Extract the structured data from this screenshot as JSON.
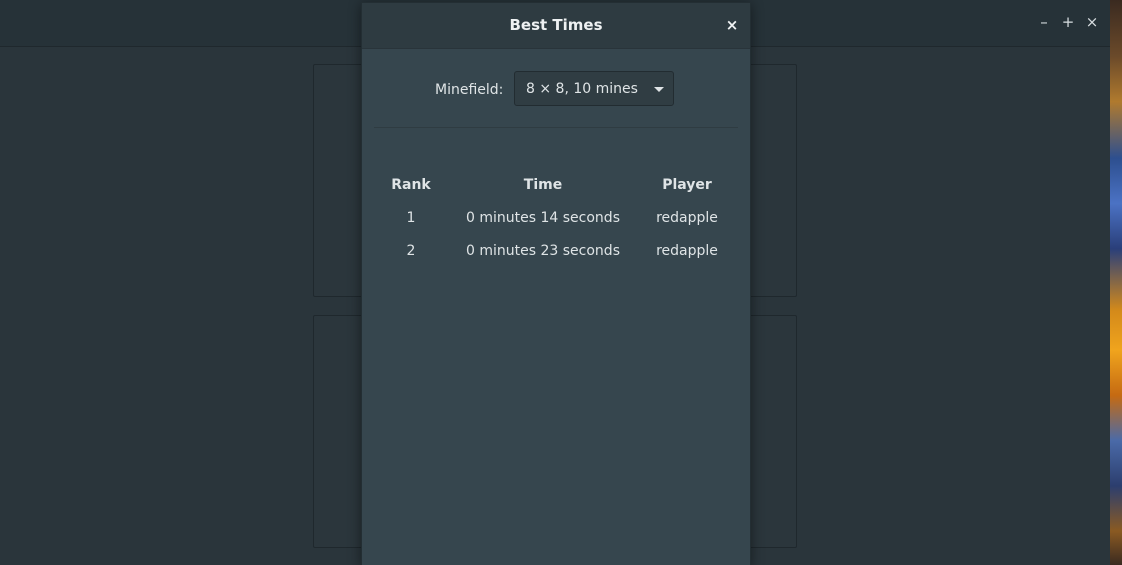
{
  "main_window": {
    "controls": {
      "minimize_icon": "–",
      "maximize_icon": "+",
      "close_icon": "×"
    }
  },
  "dialog": {
    "title": "Best Times",
    "close_icon": "×",
    "minefield": {
      "label": "Minefield:",
      "selected": "8 × 8, 10 mines"
    },
    "table": {
      "headers": [
        "Rank",
        "Time",
        "Player"
      ],
      "rows": [
        {
          "rank": "1",
          "time": "0 minutes 14 seconds",
          "player": "redapple"
        },
        {
          "rank": "2",
          "time": "0 minutes 23 seconds",
          "player": "redapple"
        }
      ]
    }
  }
}
